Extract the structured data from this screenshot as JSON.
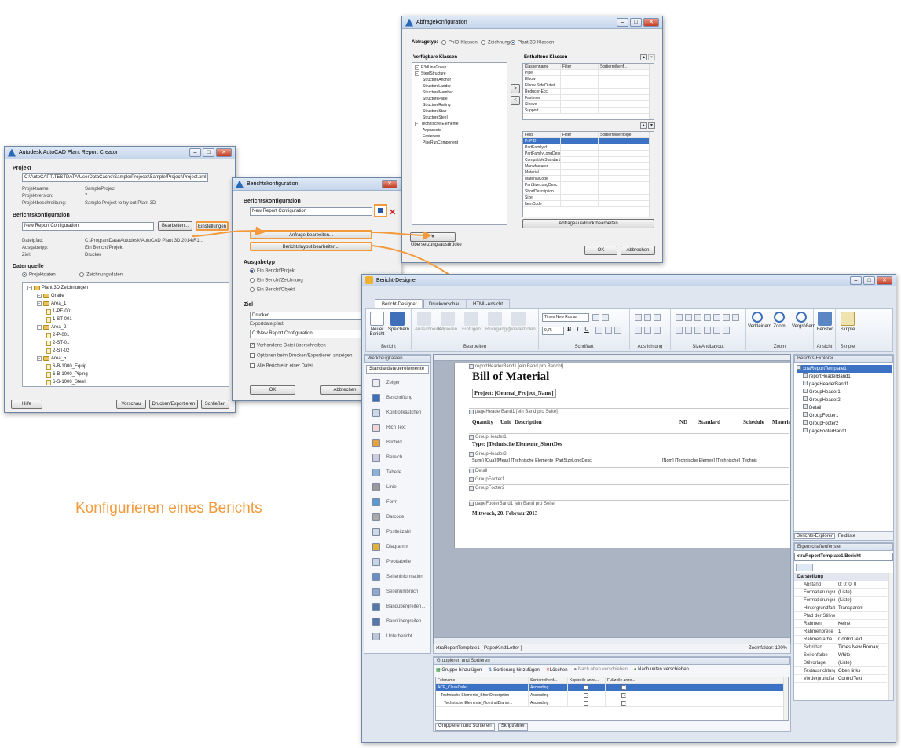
{
  "caption": "Konfigurieren eines Berichts",
  "colors": {
    "accent": "#f39a3c",
    "selection": "#3b72c4"
  },
  "creator": {
    "title": "Autodesk AutoCAD Plant Report Creator",
    "projekt_label": "Projekt",
    "projekt_path": "C:\\AutoCAPT\\TESTDATA\\UserDataCache\\Sample\\Projects\\Sample\\Project\\Project.xml",
    "info": [
      {
        "k": "Projektname:",
        "v": "SampleProject"
      },
      {
        "k": "Projektversion:",
        "v": "7"
      },
      {
        "k": "Projektbeschreibung:",
        "v": "Sample Project to try out Plant 3D"
      }
    ],
    "berichtskonfig_label": "Berichtskonfiguration",
    "config_value": "New Report Configuration",
    "bearbeiten": "Bearbeiten...",
    "einstellungen": "Einstellungen",
    "details": [
      {
        "k": "Dateipfad:",
        "v": "C:\\ProgramData\\Autodesk\\AutoCAD Plant 3D 2014\\R1..."
      },
      {
        "k": "Ausgabetyp:",
        "v": "Ein Bericht/Projekt"
      },
      {
        "k": "Ziel:",
        "v": "Drucker"
      }
    ],
    "datenquelle_label": "Datenquelle",
    "radio1": "Projektdaten",
    "radio2": "Zeichnungsdaten",
    "tree": [
      {
        "t": "Plant 3D Zeichnungen",
        "lvl": 0
      },
      {
        "t": "Grade",
        "lvl": 1
      },
      {
        "t": "Area_1",
        "lvl": 1
      },
      {
        "t": "1-PE-001",
        "lvl": 2
      },
      {
        "t": "1-ST-001",
        "lvl": 2
      },
      {
        "t": "Area_2",
        "lvl": 1
      },
      {
        "t": "2-P-001",
        "lvl": 2
      },
      {
        "t": "2-ST-01",
        "lvl": 2
      },
      {
        "t": "2-ST-02",
        "lvl": 2
      },
      {
        "t": "Area_5",
        "lvl": 1
      },
      {
        "t": "6-B-1000_Equip",
        "lvl": 2
      },
      {
        "t": "6-B-1000_Piping",
        "lvl": 2
      },
      {
        "t": "6-S-1000_Steel",
        "lvl": 2
      }
    ],
    "hilfe": "Hilfe",
    "vorschau": "Vorschau",
    "drucken": "Drucken/Exportieren",
    "schliessen": "Schließen"
  },
  "config": {
    "title": "Berichtskonfiguration",
    "label": "Berichtskonfiguration",
    "value": "New Report Configuration",
    "anfrage": "Anfrage bearbeiten...",
    "layout": "Berichtslayout bearbeiten...",
    "ausgabetyp_label": "Ausgabetyp",
    "out1": "Ein Bericht/Projekt",
    "out2": "Ein Bericht/Zeichnung",
    "out3": "Ein Bericht/Objekt",
    "ziel_label": "Ziel",
    "ziel_value": "Drucker",
    "exportpfad_label": "Exportdateipfad:",
    "exportpfad_value": "C:\\New Report Configuration",
    "cb1": "Vorhandene Datei überschreiben",
    "cb2": "Optionen beim Drucken/Exportieren anzeigen",
    "cb3": "Alle Berichte in einer Datei",
    "ok": "OK",
    "abbrechen": "Abbrechen"
  },
  "abfrage": {
    "title": "Abfragekonfiguration",
    "abfragetyp": "Abfragetyp:",
    "r1": "PnID-Klassen",
    "r2": "Zeichnungen",
    "r3": "Plant 3D-Klassen",
    "verfuegbar": "Verfügbare Klassen",
    "tree": [
      {
        "t": "P3dLineGroup",
        "lvl": 0
      },
      {
        "t": "SteelStructure",
        "lvl": 0
      },
      {
        "t": "StructureAnchor",
        "lvl": 1
      },
      {
        "t": "StructureLadder",
        "lvl": 1
      },
      {
        "t": "StructureMember",
        "lvl": 1
      },
      {
        "t": "StructurePlate",
        "lvl": 1
      },
      {
        "t": "StructureRailing",
        "lvl": 1
      },
      {
        "t": "StructureStair",
        "lvl": 1
      },
      {
        "t": "StructureSteel",
        "lvl": 1
      },
      {
        "t": "Technische Elemente",
        "lvl": 0
      },
      {
        "t": "Anpassete",
        "lvl": 1
      },
      {
        "t": "Fasteners",
        "lvl": 1
      },
      {
        "t": "PipeRunComponent",
        "lvl": 1
      }
    ],
    "enthaltene": "Enthaltene Klassen",
    "cols": [
      "Klassenname",
      "Filter",
      "Sortierreihenf..."
    ],
    "classes": [
      "Pipe",
      "Elbow",
      "Elbow SideOutlet",
      "Reducer-Ecc",
      "Fastener",
      "Sleeve",
      "Support"
    ],
    "fcols": [
      "Feld",
      "Filter",
      "Sortierreihenfolge"
    ],
    "fields": [
      "PnPID",
      "PartFamilyId",
      "PartFamilyLongDesc",
      "CompatibleStandard",
      "Manufacturer",
      "Material",
      "MaterialCode",
      "PartSizeLongDesc",
      "ShortDescription",
      "Size",
      "ItemCode"
    ],
    "abfrage_btn": "Abfrageausdruck bearbeiten",
    "uebersetzung": "Übersetzungsausdrücke",
    "ok": "OK",
    "abbrechen": "Abbrechen"
  },
  "designer": {
    "title": "Bericht-Designer",
    "tabs": [
      "Bericht-Designer",
      "Druckvorschau",
      "HTML-Ansicht"
    ],
    "ribbon": {
      "neuer": "Neuer Bericht",
      "speichern": "Speichern",
      "group_bericht": "Bericht",
      "ausschneiden": "Ausschneiden",
      "kopieren": "Kopieren",
      "einfuegen": "Einfügen",
      "rueckgaengig": "Rückgängig",
      "wiederholen": "Wiederholen",
      "group_bearbeiten": "Bearbeiten",
      "font": "Times New Roman",
      "size": "9,75",
      "group_schrift": "Schriftart",
      "group_ausrichtung": "Ausrichtung",
      "group_size": "SizeAndLayout",
      "verkleinern": "Verkleinern",
      "zoom": "Zoom",
      "vergroessern": "Vergrößern",
      "group_zoom": "Zoom",
      "fenster": "Fenster",
      "skripte": "Skripte",
      "group_ansicht": "Ansicht",
      "group_skripte": "Skripte"
    },
    "toolbox_title": "Werkzeugkasten",
    "toolbox_header": "Standardsteuerelemente",
    "tools": [
      "Zeiger",
      "Beschriftung",
      "Kontrollkästchen",
      "Rich Text",
      "Bildfeld",
      "Bereich",
      "Tabelle",
      "Linie",
      "Form",
      "Barcode",
      "Postleitzahl",
      "Diagramm",
      "Pivottabelle",
      "Seiteninformation",
      "Seitenumbruch",
      "Bandübergreifen...",
      "Bandübergreifen...",
      "Unterbericht"
    ],
    "bands": {
      "reportHeader": "reportHeaderBand1 [ein Band pro Bericht]",
      "billTitle": "Bill of Material",
      "project": "Project: [General_Project_Name]",
      "pageHeader": "pageHeaderBand1 [ein Band pro Seite]",
      "columns": [
        "Quantity",
        "Unit",
        "Description",
        "ND",
        "Standard",
        "Schedule",
        "Materia"
      ],
      "groupHeader1": "GroupHeader1",
      "typeLine": "Type: [Technische Elemente_ShortDes",
      "groupHeader2": "GroupHeader2",
      "groupLine": "Sum() [Qua] [Meas] [Technische Elemente_PartSizeLongDesc]",
      "groupLine2": "[Nom] [Technische Elemen] [Technische] [Technis",
      "detail": "Detail",
      "groupFooter1": "GroupFooter1",
      "groupFooter2": "GroupFooter2",
      "pageFooter": "pageFooterBand1 [ein Band pro Seite]",
      "footerDate": "Mittwoch, 20. Februar 2013"
    },
    "status_left": "xtraReportTemplate1 { PaperKind:Letter }",
    "status_right": "Zoomfaktor: 100%",
    "gs_title": "Gruppieren und Sortieren",
    "gs_add_group": "Gruppe hinzufügen",
    "gs_add_sort": "Sortierung hinzufügen",
    "gs_delete": "Löschen",
    "gs_up": "Nach oben verschieben",
    "gs_down": "Nach unten verschieben",
    "gs_cols": [
      "Feldname",
      "Sortierreihenf...",
      "Kopfzeile anze...",
      "Fußzeile anze..."
    ],
    "gs_rows": [
      {
        "name": "ACP_ClassOrder",
        "sort": "Ascending",
        "sel": true
      },
      {
        "name": "Technische Elemente_ShortDescription",
        "sort": "Ascending",
        "sel": false
      },
      {
        "name": "Technische Elemente_NominalDiame...",
        "sort": "Ascending",
        "sel": false
      }
    ],
    "bottom_tab1": "Gruppieren und Sortieren",
    "bottom_tab2": "Skriptfehler",
    "explorer_title": "Berichts-Explorer",
    "explorer": [
      {
        "t": "xtraReportTemplate1",
        "lvl": 0,
        "sel": true
      },
      {
        "t": "reportHeaderBand1",
        "lvl": 1
      },
      {
        "t": "pageHeaderBand1",
        "lvl": 1
      },
      {
        "t": "GroupHeader1",
        "lvl": 1
      },
      {
        "t": "GroupHeader2",
        "lvl": 1
      },
      {
        "t": "Detail",
        "lvl": 1
      },
      {
        "t": "GroupFooter1",
        "lvl": 1
      },
      {
        "t": "GroupFooter2",
        "lvl": 1
      },
      {
        "t": "pageFooterBand1",
        "lvl": 1
      }
    ],
    "exp_tab1": "Berichts-Explorer",
    "exp_tab2": "Feldliste",
    "props_title": "Eigenschaftenfenster",
    "props_object": "xtraReportTemplate1  Bericht",
    "props_cat1": "Darstellung",
    "props": [
      {
        "k": "Abstand",
        "v": "0; 0; 0; 0"
      },
      {
        "k": "Formatierungsre",
        "v": "(Liste)"
      },
      {
        "k": "Formatierungsre",
        "v": "(Liste)"
      },
      {
        "k": "Hintergrundfarbe",
        "v": "Transparent"
      },
      {
        "k": "Pfad der Stilvorla",
        "v": ""
      },
      {
        "k": "Rahmen",
        "v": "Keine"
      },
      {
        "k": "Rahmenbreite",
        "v": "1"
      },
      {
        "k": "Rahmenfarbe",
        "v": "ControlText"
      },
      {
        "k": "Schriftart",
        "v": "Times New Roman;..."
      },
      {
        "k": "Seitenfarbe",
        "v": "White"
      },
      {
        "k": "Stilvorlage",
        "v": "(Liste)"
      },
      {
        "k": "Textausrichtung",
        "v": "Oben links"
      },
      {
        "k": "Vordergrundfarbe",
        "v": "ControlText"
      }
    ]
  }
}
